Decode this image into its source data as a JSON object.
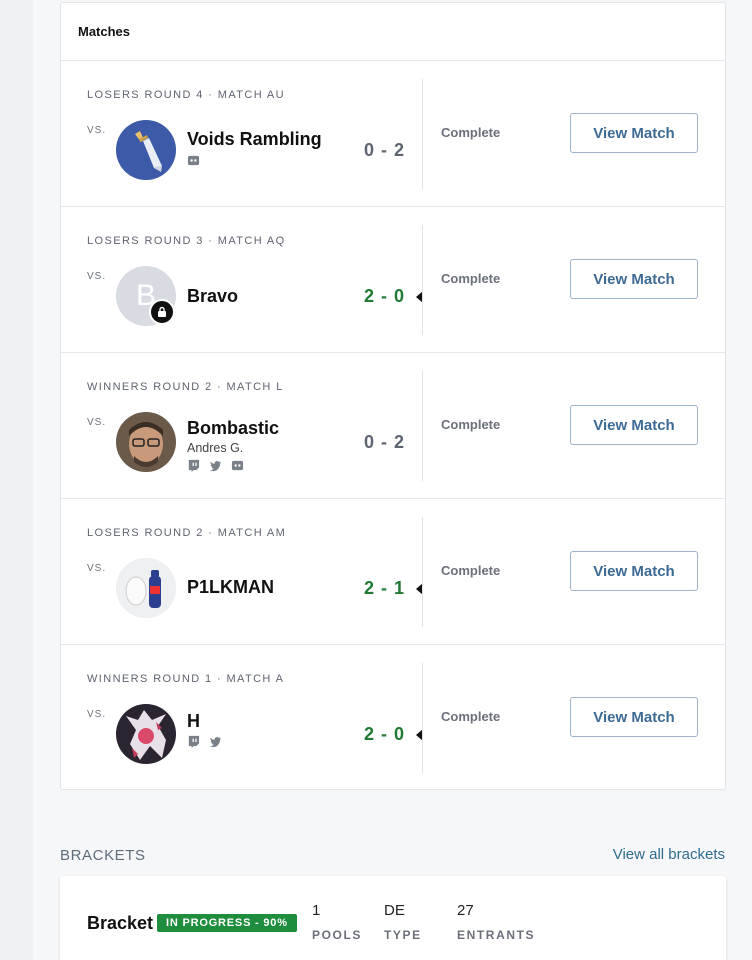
{
  "matches_card": {
    "title": "Matches",
    "items": [
      {
        "round": "LOSERS ROUND 4 · MATCH AU",
        "vs": "VS.",
        "player": "Voids Rambling",
        "subname": "",
        "socials": [
          "discord-icon"
        ],
        "score": "0 - 2",
        "won": false,
        "status": "Complete",
        "button": "View Match"
      },
      {
        "round": "LOSERS ROUND 3 · MATCH AQ",
        "vs": "VS.",
        "player": "Bravo",
        "avatar_letter": "B",
        "subname": "",
        "socials": [],
        "score": "2 - 0",
        "won": true,
        "status": "Complete",
        "button": "View Match"
      },
      {
        "round": "WINNERS ROUND 2 · MATCH L",
        "vs": "VS.",
        "player": "Bombastic",
        "subname": "Andres G.",
        "socials": [
          "twitch-icon",
          "twitter-icon",
          "discord-icon"
        ],
        "score": "0 - 2",
        "won": false,
        "status": "Complete",
        "button": "View Match"
      },
      {
        "round": "LOSERS ROUND 2 · MATCH AM",
        "vs": "VS.",
        "player": "P1LKMAN",
        "subname": "",
        "socials": [],
        "score": "2 - 1",
        "won": true,
        "status": "Complete",
        "button": "View Match"
      },
      {
        "round": "WINNERS ROUND 1 · MATCH A",
        "vs": "VS.",
        "player": "H",
        "subname": "",
        "socials": [
          "twitch-icon",
          "twitter-icon"
        ],
        "score": "2 - 0",
        "won": true,
        "status": "Complete",
        "button": "View Match"
      }
    ]
  },
  "brackets": {
    "title": "BRACKETS",
    "view_all": "View all brackets",
    "bracket": {
      "name": "Bracket",
      "badge": "IN PROGRESS - 90%",
      "progress_percent": 90,
      "stats": [
        {
          "value": "1",
          "label": "POOLS"
        },
        {
          "value": "DE",
          "label": "TYPE"
        },
        {
          "value": "27",
          "label": "ENTRANTS"
        }
      ]
    }
  },
  "colors": {
    "win_score": "#1f7a34",
    "loss_score": "#5e6470",
    "button_text": "#3d6a94",
    "badge_bg": "#1e8d3d",
    "link": "#2f6b8c"
  }
}
